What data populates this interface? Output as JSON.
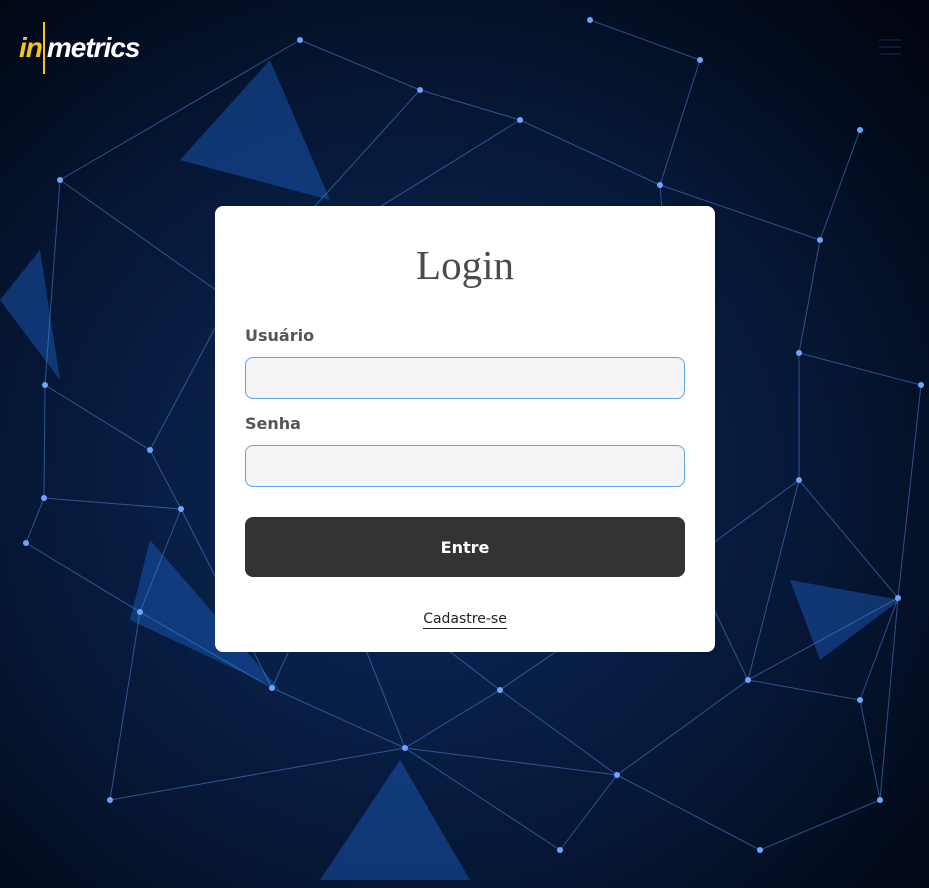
{
  "brand": {
    "logo_in": "in",
    "logo_metrics": "metrics",
    "accent_color": "#f5c518"
  },
  "header": {
    "menu_icon": "hamburger-menu-icon"
  },
  "login": {
    "title": "Login",
    "username_label": "Usuário",
    "username_value": "",
    "password_label": "Senha",
    "password_value": "",
    "submit_label": "Entre",
    "signup_link": "Cadastre-se"
  },
  "colors": {
    "background": "#020a1a",
    "card": "#ffffff",
    "button": "#333333",
    "input_border": "#5aa6e6",
    "input_bg": "#f5f5f5"
  }
}
